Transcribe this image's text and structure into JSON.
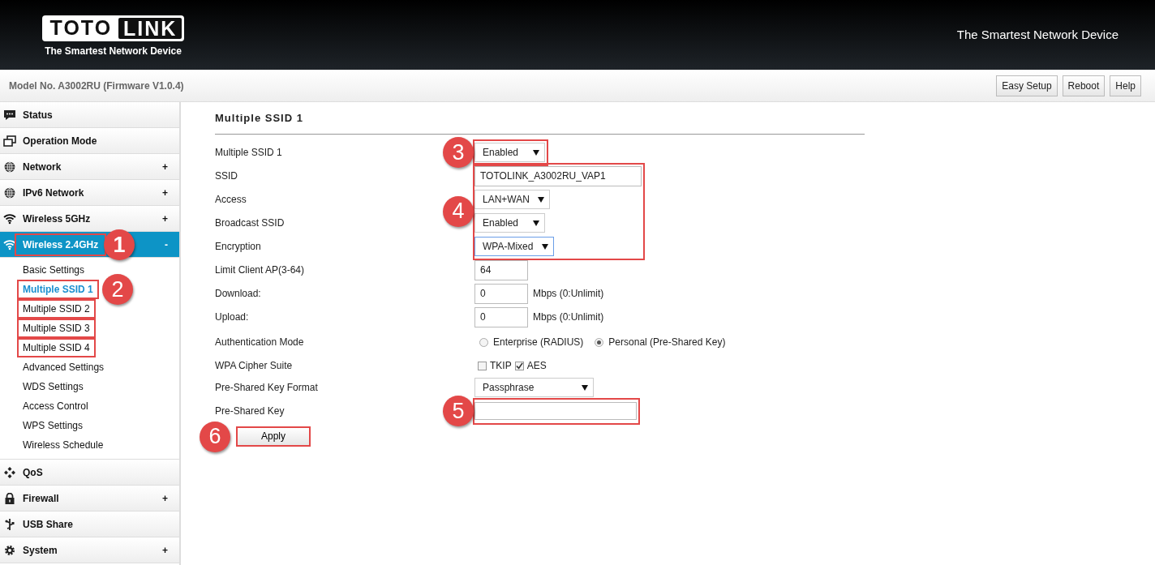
{
  "header": {
    "logo_left": "TOTO",
    "logo_right": "LINK",
    "logo_tagline": "The Smartest Network Device",
    "slogan": "The Smartest Network Device"
  },
  "toolbar": {
    "model": "Model No. A3002RU (Firmware V1.0.4)",
    "buttons": [
      "Easy Setup",
      "Reboot",
      "Help"
    ]
  },
  "sidebar": {
    "items": [
      {
        "label": "Status",
        "selected": false,
        "highlighted": false
      },
      {
        "label": "Operation Mode",
        "selected": false,
        "highlighted": false
      },
      {
        "label": "Network",
        "toggle": "+",
        "selected": false,
        "highlighted": false
      },
      {
        "label": "IPv6 Network",
        "toggle": "+",
        "selected": false,
        "highlighted": false
      },
      {
        "label": "Wireless 5GHz",
        "toggle": "+",
        "selected": false,
        "highlighted": false
      },
      {
        "label": "Wireless 2.4GHz",
        "toggle": "-",
        "selected": true,
        "highlighted": true,
        "callout": "1",
        "children": [
          {
            "label": "Basic Settings",
            "selected": false,
            "highlighted": false
          },
          {
            "label": "Multiple SSID 1",
            "selected": true,
            "highlighted": true,
            "callout": "2"
          },
          {
            "label": "Multiple SSID 2",
            "selected": false,
            "highlighted": true
          },
          {
            "label": "Multiple SSID 3",
            "selected": false,
            "highlighted": true
          },
          {
            "label": "Multiple SSID 4",
            "selected": false,
            "highlighted": true
          },
          {
            "label": "Advanced Settings",
            "selected": false,
            "highlighted": false
          },
          {
            "label": "WDS Settings",
            "selected": false,
            "highlighted": false
          },
          {
            "label": "Access Control",
            "selected": false,
            "highlighted": false
          },
          {
            "label": "WPS Settings",
            "selected": false,
            "highlighted": false
          },
          {
            "label": "Wireless Schedule",
            "selected": false,
            "highlighted": false
          }
        ]
      },
      {
        "label": "QoS",
        "selected": false,
        "highlighted": false
      },
      {
        "label": "Firewall",
        "toggle": "+",
        "selected": false,
        "highlighted": false
      },
      {
        "label": "USB Share",
        "selected": false,
        "highlighted": false
      },
      {
        "label": "System",
        "toggle": "+",
        "selected": false,
        "highlighted": false
      }
    ]
  },
  "form": {
    "title": "Multiple SSID 1",
    "groups": [
      {
        "callout": "3",
        "rows": [
          {
            "label": "Multiple SSID 1",
            "kind": "select",
            "value": "Enabled",
            "focused": false
          }
        ]
      },
      {
        "callout": "4",
        "rows": [
          {
            "label": "SSID",
            "kind": "text",
            "value": "TOTOLINK_A3002RU_VAP1"
          },
          {
            "label": "Access",
            "kind": "select",
            "value": "LAN+WAN",
            "focused": false
          },
          {
            "label": "Broadcast SSID",
            "kind": "select",
            "value": "Enabled",
            "focused": false
          },
          {
            "label": "Encryption",
            "kind": "select",
            "value": "WPA-Mixed",
            "focused": true
          }
        ]
      },
      {
        "rows": [
          {
            "label": "Limit Client AP(3-64)",
            "kind": "text",
            "value": "64"
          },
          {
            "label": "Download:",
            "kind": "text",
            "value": "0",
            "suffix": "Mbps (0:Unlimit)"
          },
          {
            "label": "Upload:",
            "kind": "text",
            "value": "0",
            "suffix": "Mbps (0:Unlimit)"
          },
          {
            "label": "Authentication Mode",
            "kind": "radio",
            "options": [
              {
                "label": "Enterprise (RADIUS)",
                "selected": false
              },
              {
                "label": "Personal (Pre-Shared Key)",
                "selected": true
              }
            ]
          },
          {
            "label": "WPA Cipher Suite",
            "kind": "checkbox",
            "options": [
              {
                "label": "TKIP",
                "checked": false
              },
              {
                "label": "AES",
                "checked": true
              }
            ]
          },
          {
            "label": "Pre-Shared Key Format",
            "kind": "select",
            "value": "Passphrase",
            "focused": false
          }
        ]
      },
      {
        "callout": "5",
        "rows": [
          {
            "label": "Pre-Shared Key",
            "kind": "password"
          }
        ]
      }
    ],
    "apply": {
      "label": "Apply",
      "callout": "6"
    }
  }
}
